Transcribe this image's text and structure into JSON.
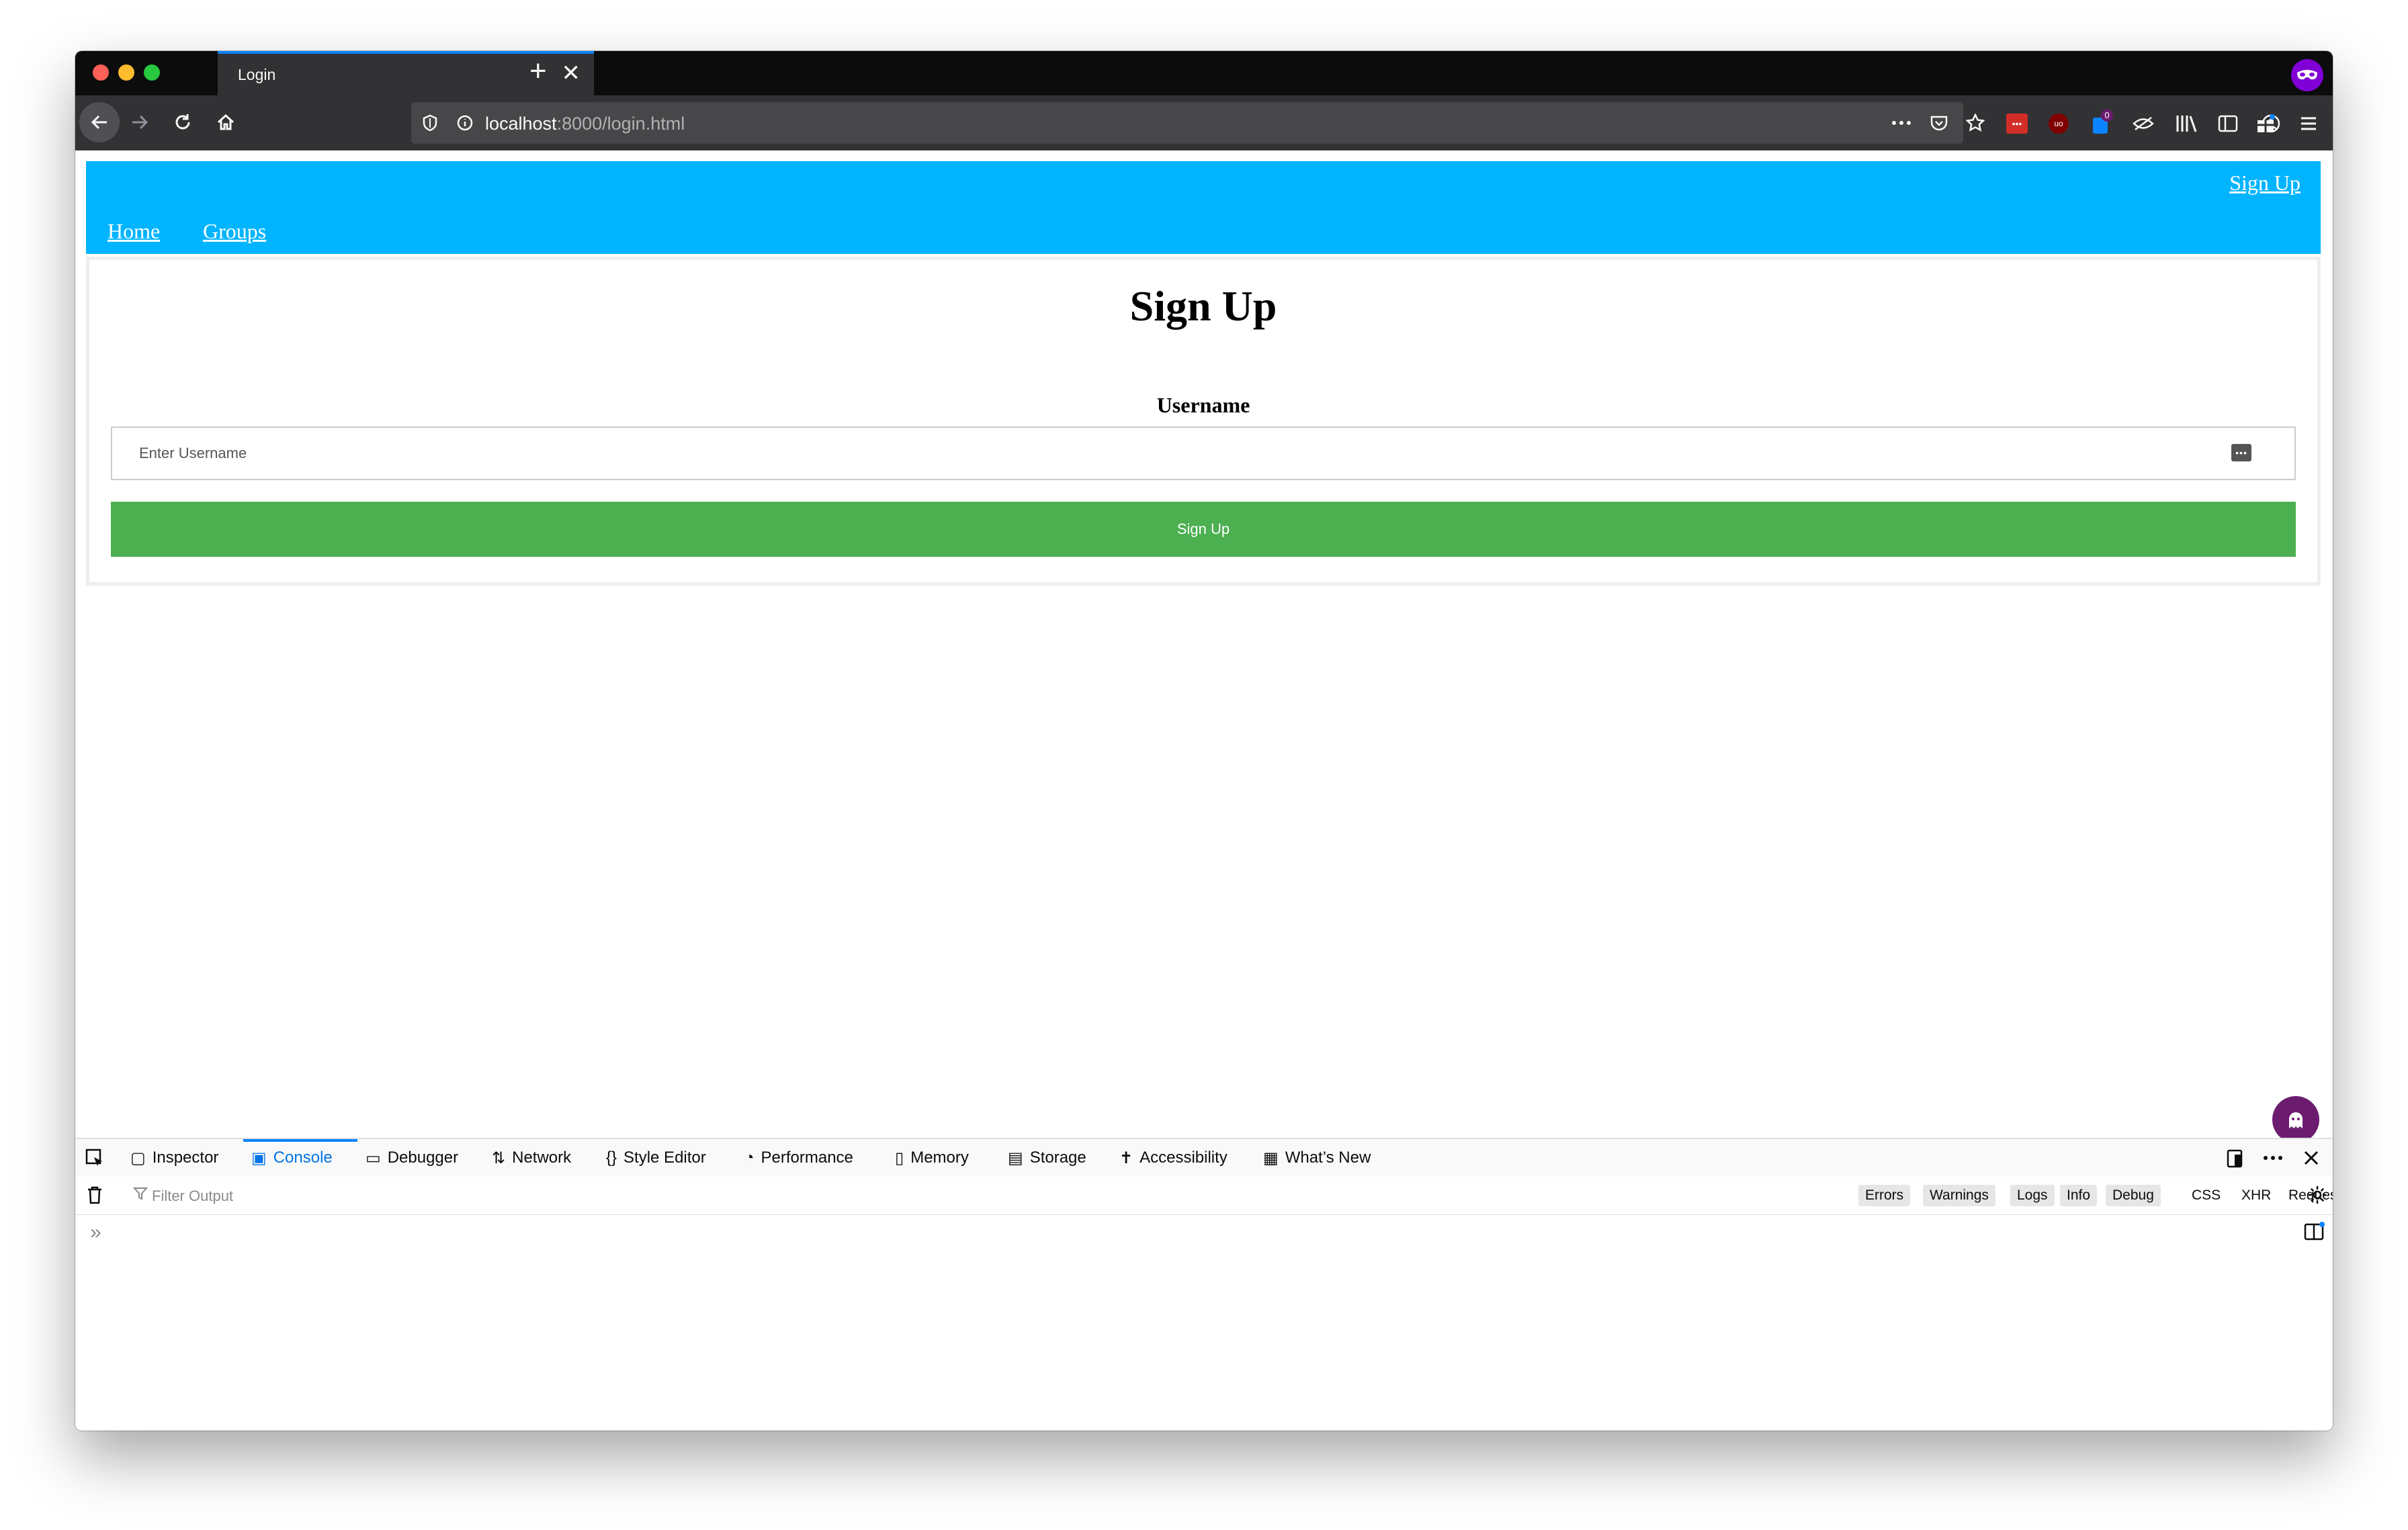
{
  "browser": {
    "tab_title": "Login",
    "url_host": "localhost",
    "url_rest": ":8000/login.html",
    "new_tab_label": "+",
    "close_label": "✕"
  },
  "site": {
    "nav_signup": "Sign Up",
    "nav_home": "Home",
    "nav_groups": "Groups",
    "heading": "Sign Up",
    "username_label": "Username",
    "username_placeholder": "Enter Username",
    "username_value": "",
    "submit_label": "Sign Up",
    "nav_color": "#00b4ff",
    "button_color": "#4caf50"
  },
  "devtools": {
    "tabs": [
      "Inspector",
      "Console",
      "Debugger",
      "Network",
      "Style Editor",
      "Performance",
      "Memory",
      "Storage",
      "Accessibility",
      "What’s New"
    ],
    "active_tab": "Console",
    "filter_placeholder": "Filter Output",
    "levels": [
      "Errors",
      "Warnings",
      "Logs",
      "Info",
      "Debug"
    ],
    "extra_filters": [
      "CSS",
      "XHR",
      "Requests"
    ],
    "prompt": "»"
  },
  "toolbar": {
    "ublock_badge": "0"
  }
}
